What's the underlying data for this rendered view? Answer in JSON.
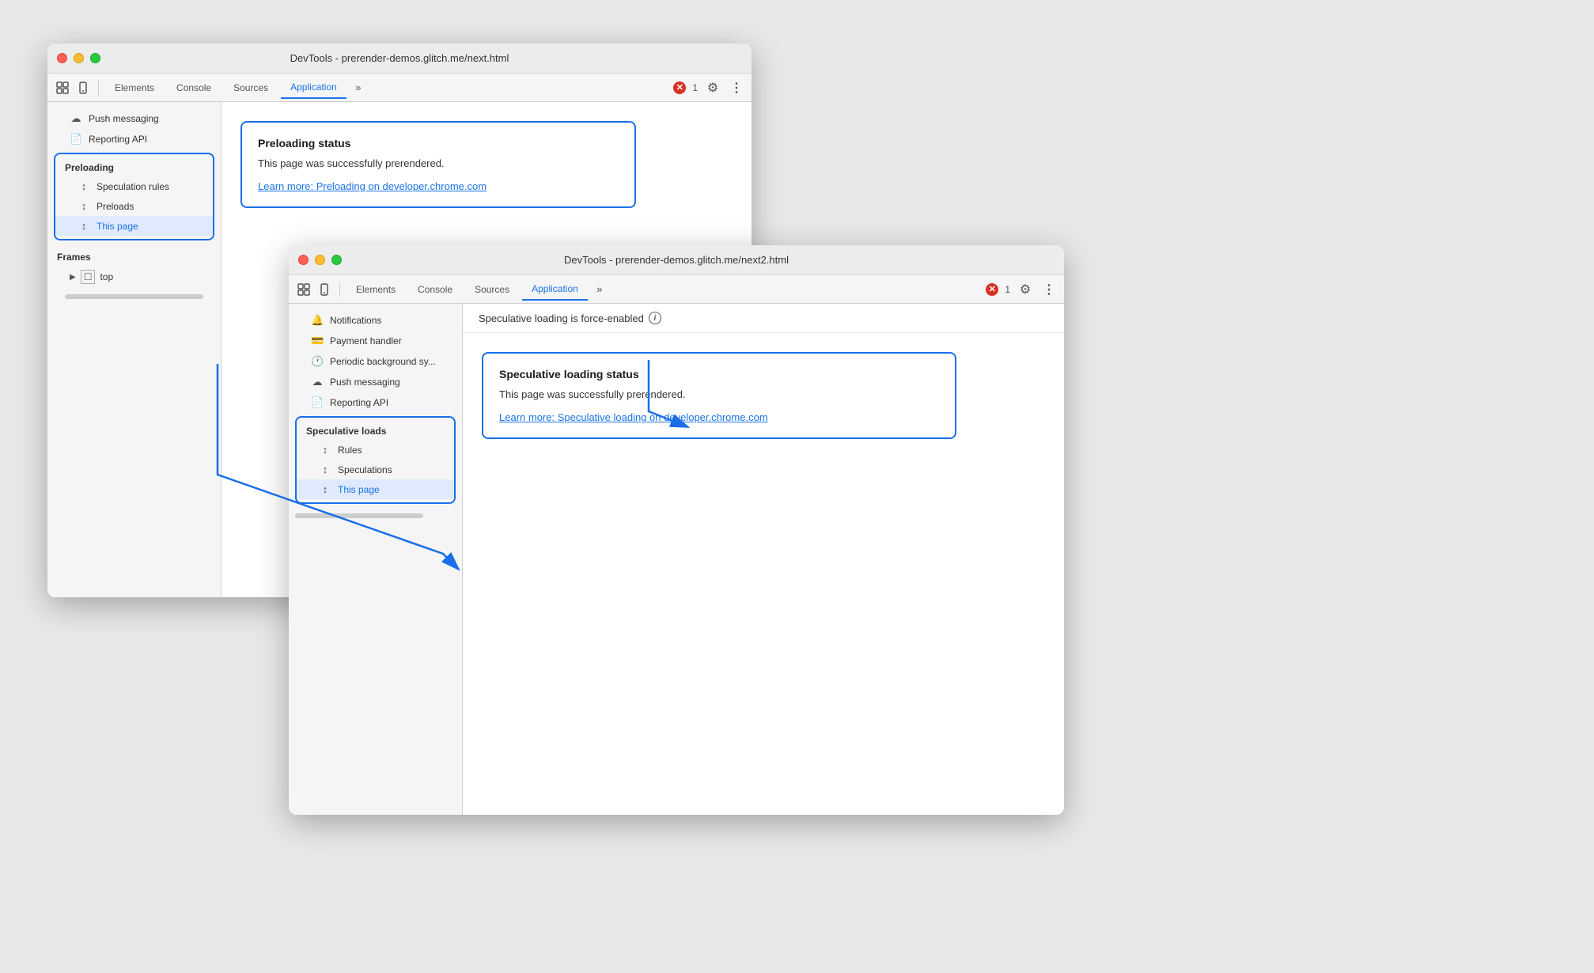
{
  "window1": {
    "title": "DevTools - prerender-demos.glitch.me/next.html",
    "tabs": [
      "Elements",
      "Console",
      "Sources",
      "Application"
    ],
    "active_tab": "Application",
    "error_count": "1",
    "sidebar": {
      "sections": [
        {
          "name": "Push messaging",
          "icon": "☁"
        },
        {
          "name": "Reporting API",
          "icon": "📄"
        }
      ],
      "preloading_section": {
        "header": "Preloading",
        "items": [
          {
            "label": "Speculation rules",
            "icon": "↕"
          },
          {
            "label": "Preloads",
            "icon": "↕"
          },
          {
            "label": "This page",
            "icon": "↕",
            "active": true
          }
        ]
      },
      "frames_section": {
        "header": "Frames",
        "top_label": "top"
      }
    },
    "main": {
      "status_box": {
        "title": "Preloading status",
        "text": "This page was successfully prerendered.",
        "link": "Learn more: Preloading on developer.chrome.com"
      }
    }
  },
  "window2": {
    "title": "DevTools - prerender-demos.glitch.me/next2.html",
    "tabs": [
      "Elements",
      "Console",
      "Sources",
      "Application"
    ],
    "active_tab": "Application",
    "error_count": "1",
    "sidebar": {
      "sections": [
        {
          "name": "Notifications",
          "icon": "🔔"
        },
        {
          "name": "Payment handler",
          "icon": "💳"
        },
        {
          "name": "Periodic background sync",
          "icon": "🕐"
        },
        {
          "name": "Push messaging",
          "icon": "☁"
        },
        {
          "name": "Reporting API",
          "icon": "📄"
        }
      ],
      "speculative_section": {
        "header": "Speculative loads",
        "items": [
          {
            "label": "Rules",
            "icon": "↕"
          },
          {
            "label": "Speculations",
            "icon": "↕"
          },
          {
            "label": "This page",
            "icon": "↕",
            "active": true
          }
        ]
      }
    },
    "force_enabled_text": "Speculative loading is force-enabled",
    "main": {
      "status_box": {
        "title": "Speculative loading status",
        "text": "This page was successfully prerendered.",
        "link": "Learn more: Speculative loading on developer.chrome.com"
      }
    }
  },
  "icons": {
    "cursor": "⬚",
    "device": "📱",
    "chevron_right": "»",
    "more": "⋮",
    "gear": "⚙",
    "grid": "⊞",
    "triangle_right": "▶",
    "square": "☐",
    "frame_icon": "☐"
  }
}
